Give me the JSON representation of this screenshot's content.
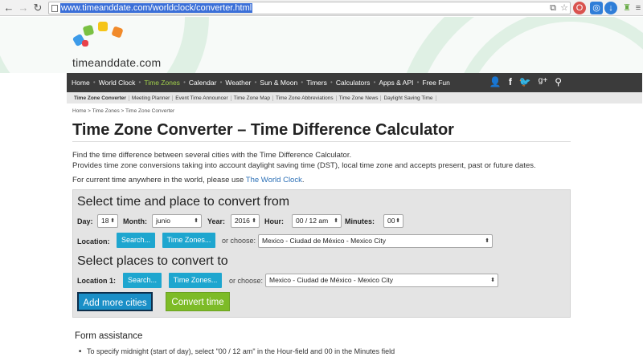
{
  "browser": {
    "url": "www.timeanddate.com/worldclock/converter.html"
  },
  "site": {
    "logo_text": "timeanddate.com",
    "nav": [
      "Home",
      "World Clock",
      "Time Zones",
      "Calendar",
      "Weather",
      "Sun & Moon",
      "Timers",
      "Calculators",
      "Apps & API",
      "Free Fun"
    ],
    "nav_active": "Time Zones",
    "subnav": [
      "Time Zone Converter",
      "Meeting Planner",
      "Event Time Announcer",
      "Time Zone Map",
      "Time Zone Abbreviations",
      "Time Zone News",
      "Daylight Saving Time"
    ],
    "breadcrumb": "Home > Time Zones > Time Zone Converter"
  },
  "page": {
    "title": "Time Zone Converter – Time Difference Calculator",
    "intro_line1": "Find the time difference between several cities with the Time Difference Calculator.",
    "intro_line2": "Provides time zone conversions taking into account daylight saving time (DST), local time zone and accepts present, past or future dates.",
    "intro_line3_prefix": "For current time anywhere in the world, please use ",
    "intro_line3_link": "The World Clock",
    "intro_line3_suffix": "."
  },
  "form": {
    "from_heading": "Select time and place to convert from",
    "day_label": "Day:",
    "day_value": "18",
    "month_label": "Month:",
    "month_value": "junio",
    "year_label": "Year:",
    "year_value": "2016",
    "hour_label": "Hour:",
    "hour_value": "00 / 12 am",
    "minutes_label": "Minutes:",
    "minutes_value": "00",
    "location_label": "Location:",
    "search_label": "Search...",
    "timezones_label": "Time Zones...",
    "or_choose": "or choose:",
    "location_value": "Mexico - Ciudad de México - Mexico City",
    "to_heading": "Select places to convert to",
    "location1_label": "Location 1:",
    "location1_value": "Mexico - Ciudad de México - Mexico City",
    "add_more_label": "Add more cities",
    "convert_label": "Convert time"
  },
  "assistance": {
    "title": "Form assistance",
    "item1": "To specify midnight (start of day), select \"00 / 12 am\" in the Hour-field and 00 in the Minutes field"
  },
  "colors": {
    "nav_bg": "#3b3b3b",
    "nav_active": "#a2d04c",
    "button_blue": "#1ea6cf",
    "button_green": "#7dbb27",
    "link": "#2b6fb6"
  }
}
